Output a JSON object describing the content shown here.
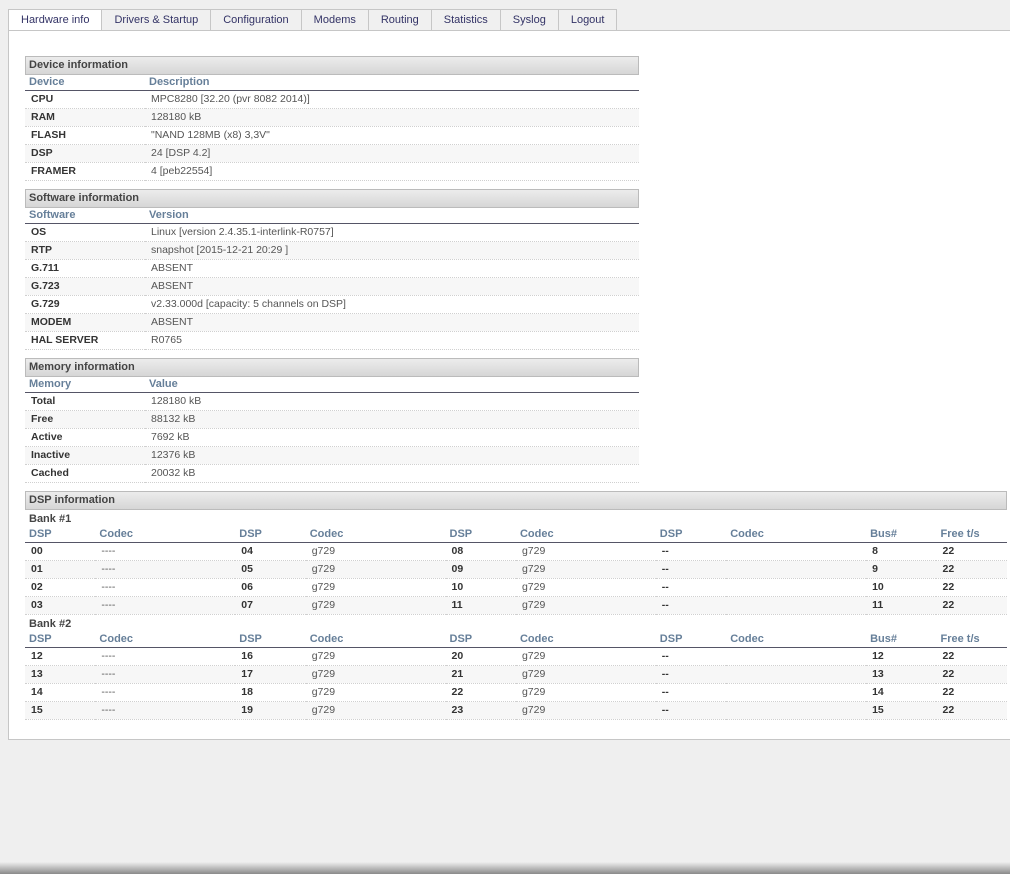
{
  "tabs": [
    {
      "label": "Hardware info",
      "active": true
    },
    {
      "label": "Drivers & Startup",
      "active": false
    },
    {
      "label": "Configuration",
      "active": false
    },
    {
      "label": "Modems",
      "active": false
    },
    {
      "label": "Routing",
      "active": false
    },
    {
      "label": "Statistics",
      "active": false
    },
    {
      "label": "Syslog",
      "active": false
    },
    {
      "label": "Logout",
      "active": false
    }
  ],
  "device": {
    "title": "Device information",
    "col1": "Device",
    "col2": "Description",
    "rows": [
      [
        "CPU",
        "MPC8280 [32.20 (pvr 8082 2014)]"
      ],
      [
        "RAM",
        "128180 kB"
      ],
      [
        "FLASH",
        "\"NAND 128MB (x8) 3,3V\""
      ],
      [
        "DSP",
        "24 [DSP 4.2]"
      ],
      [
        "FRAMER",
        "4 [peb22554]"
      ]
    ]
  },
  "software": {
    "title": "Software information",
    "col1": "Software",
    "col2": "Version",
    "rows": [
      [
        "OS",
        "Linux [version 2.4.35.1-interlink-R0757]"
      ],
      [
        "RTP",
        "snapshot [2015-12-21 20:29 ]"
      ],
      [
        "G.711",
        "ABSENT"
      ],
      [
        "G.723",
        "ABSENT"
      ],
      [
        "G.729",
        "v2.33.000d [capacity: 5 channels on DSP]"
      ],
      [
        "MODEM",
        "ABSENT"
      ],
      [
        "HAL SERVER",
        "R0765"
      ]
    ]
  },
  "memory": {
    "title": "Memory information",
    "col1": "Memory",
    "col2": "Value",
    "rows": [
      [
        "Total",
        "128180 kB"
      ],
      [
        "Free",
        "88132 kB"
      ],
      [
        "Active",
        "7692 kB"
      ],
      [
        "Inactive",
        "12376 kB"
      ],
      [
        "Cached",
        "20032 kB"
      ]
    ]
  },
  "dsp": {
    "title": "DSP information",
    "headers": [
      "DSP",
      "Codec",
      "DSP",
      "Codec",
      "DSP",
      "Codec",
      "DSP",
      "Codec",
      "Bus#",
      "Free t/s"
    ],
    "banks": [
      {
        "label": "Bank #1",
        "rows": [
          [
            "00",
            "----",
            "04",
            "g729",
            "08",
            "g729",
            "--",
            "",
            "8",
            "22"
          ],
          [
            "01",
            "----",
            "05",
            "g729",
            "09",
            "g729",
            "--",
            "",
            "9",
            "22"
          ],
          [
            "02",
            "----",
            "06",
            "g729",
            "10",
            "g729",
            "--",
            "",
            "10",
            "22"
          ],
          [
            "03",
            "----",
            "07",
            "g729",
            "11",
            "g729",
            "--",
            "",
            "11",
            "22"
          ]
        ]
      },
      {
        "label": "Bank #2",
        "rows": [
          [
            "12",
            "----",
            "16",
            "g729",
            "20",
            "g729",
            "--",
            "",
            "12",
            "22"
          ],
          [
            "13",
            "----",
            "17",
            "g729",
            "21",
            "g729",
            "--",
            "",
            "13",
            "22"
          ],
          [
            "14",
            "----",
            "18",
            "g729",
            "22",
            "g729",
            "--",
            "",
            "14",
            "22"
          ],
          [
            "15",
            "----",
            "19",
            "g729",
            "23",
            "g729",
            "--",
            "",
            "15",
            "22"
          ]
        ]
      }
    ]
  }
}
